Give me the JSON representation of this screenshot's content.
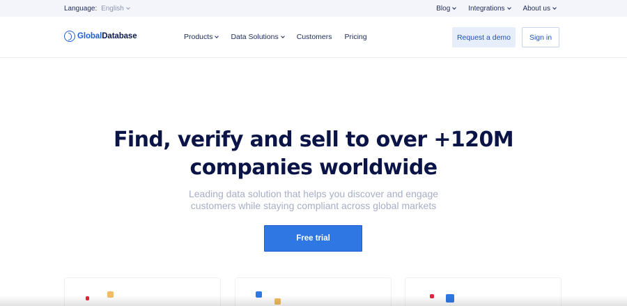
{
  "topbar": {
    "language_label": "Language:",
    "language_value": "English",
    "links": [
      "Blog",
      "Integrations",
      "About us"
    ]
  },
  "navbar": {
    "logo_part1": "Global",
    "logo_part2": "Database",
    "links": [
      "Products",
      "Data Solutions",
      "Customers",
      "Pricing"
    ],
    "demo_button": "Request a demo",
    "signin_button": "Sign in"
  },
  "hero": {
    "title_line1": "Find, verify and sell to over +120M",
    "title_line2": "companies worldwide",
    "subtitle_line1": "Leading data solution that helps you discover and engage",
    "subtitle_line2": "customers while staying compliant across global markets",
    "cta": "Free trial"
  },
  "colors": {
    "brand_blue": "#2f78e3",
    "navy": "#0a1446",
    "accent_red": "#e2233a",
    "accent_yellow": "#f1bd5e"
  }
}
